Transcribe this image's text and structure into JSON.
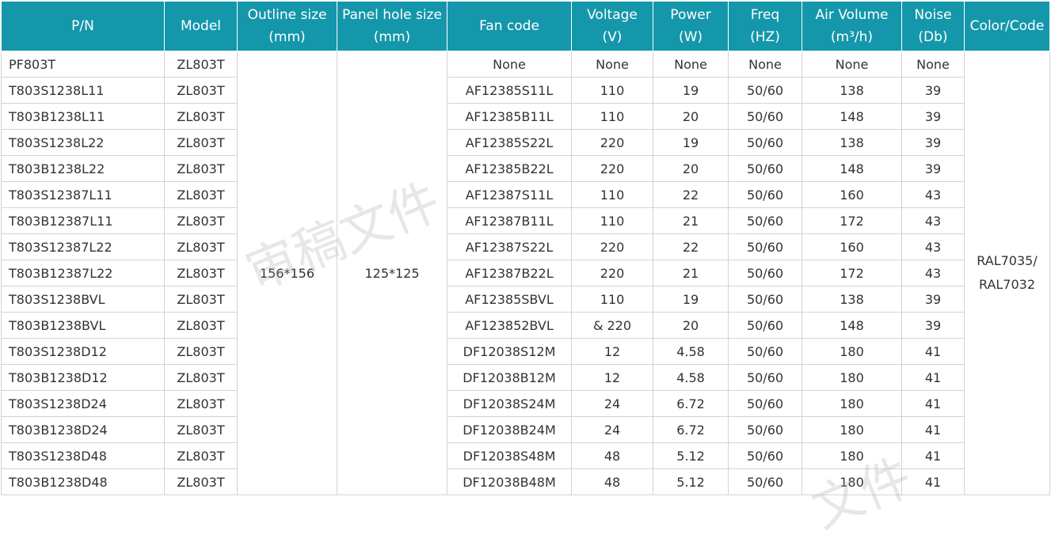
{
  "header": {
    "pn": [
      "P/N"
    ],
    "model": [
      "Model"
    ],
    "outline": [
      "Outline size",
      "(mm)"
    ],
    "panel": [
      "Panel hole size",
      "(mm)"
    ],
    "fan": [
      "Fan code"
    ],
    "voltage": [
      "Voltage",
      "(V)"
    ],
    "power": [
      "Power",
      "(W)"
    ],
    "freq": [
      "Freq",
      "(HZ)"
    ],
    "air": [
      "Air Volume",
      "(m³/h)"
    ],
    "noise": [
      "Noise",
      "(Db)"
    ],
    "color": [
      "Color/Code"
    ]
  },
  "merged": {
    "outline_size": "156*156",
    "panel_hole_size": "125*125",
    "color_code": [
      "RAL7035/",
      "RAL7032"
    ]
  },
  "rows": [
    {
      "pn": "PF803T",
      "model": "ZL803T",
      "fan": "None",
      "voltage": "None",
      "power": "None",
      "freq": "None",
      "air": "None",
      "noise": "None"
    },
    {
      "pn": "T803S1238L11",
      "model": "ZL803T",
      "fan": "AF12385S11L",
      "voltage": "110",
      "power": "19",
      "freq": "50/60",
      "air": "138",
      "noise": "39"
    },
    {
      "pn": "T803B1238L11",
      "model": "ZL803T",
      "fan": "AF12385B11L",
      "voltage": "110",
      "power": "20",
      "freq": "50/60",
      "air": "148",
      "noise": "39"
    },
    {
      "pn": "T803S1238L22",
      "model": "ZL803T",
      "fan": "AF12385S22L",
      "voltage": "220",
      "power": "19",
      "freq": "50/60",
      "air": "138",
      "noise": "39"
    },
    {
      "pn": "T803B1238L22",
      "model": "ZL803T",
      "fan": "AF12385B22L",
      "voltage": "220",
      "power": "20",
      "freq": "50/60",
      "air": "148",
      "noise": "39"
    },
    {
      "pn": "T803S12387L11",
      "model": "ZL803T",
      "fan": "AF12387S11L",
      "voltage": "110",
      "power": "22",
      "freq": "50/60",
      "air": "160",
      "noise": "43"
    },
    {
      "pn": "T803B12387L11",
      "model": "ZL803T",
      "fan": "AF12387B11L",
      "voltage": "110",
      "power": "21",
      "freq": "50/60",
      "air": "172",
      "noise": "43"
    },
    {
      "pn": "T803S12387L22",
      "model": "ZL803T",
      "fan": "AF12387S22L",
      "voltage": "220",
      "power": "22",
      "freq": "50/60",
      "air": "160",
      "noise": "43"
    },
    {
      "pn": "T803B12387L22",
      "model": "ZL803T",
      "fan": "AF12387B22L",
      "voltage": "220",
      "power": "21",
      "freq": "50/60",
      "air": "172",
      "noise": "43"
    },
    {
      "pn": "T803S1238BVL",
      "model": "ZL803T",
      "fan": "AF12385SBVL",
      "voltage": "110",
      "power": "19",
      "freq": "50/60",
      "air": "138",
      "noise": "39"
    },
    {
      "pn": "T803B1238BVL",
      "model": "ZL803T",
      "fan": "AF123852BVL",
      "voltage": "& 220",
      "power": "20",
      "freq": "50/60",
      "air": "148",
      "noise": "39"
    },
    {
      "pn": "T803S1238D12",
      "model": "ZL803T",
      "fan": "DF12038S12M",
      "voltage": "12",
      "power": "4.58",
      "freq": "50/60",
      "air": "180",
      "noise": "41"
    },
    {
      "pn": "T803B1238D12",
      "model": "ZL803T",
      "fan": "DF12038B12M",
      "voltage": "12",
      "power": "4.58",
      "freq": "50/60",
      "air": "180",
      "noise": "41"
    },
    {
      "pn": "T803S1238D24",
      "model": "ZL803T",
      "fan": "DF12038S24M",
      "voltage": "24",
      "power": "6.72",
      "freq": "50/60",
      "air": "180",
      "noise": "41"
    },
    {
      "pn": "T803B1238D24",
      "model": "ZL803T",
      "fan": "DF12038B24M",
      "voltage": "24",
      "power": "6.72",
      "freq": "50/60",
      "air": "180",
      "noise": "41"
    },
    {
      "pn": "T803S1238D48",
      "model": "ZL803T",
      "fan": "DF12038S48M",
      "voltage": "48",
      "power": "5.12",
      "freq": "50/60",
      "air": "180",
      "noise": "41"
    },
    {
      "pn": "T803B1238D48",
      "model": "ZL803T",
      "fan": "DF12038B48M",
      "voltage": "48",
      "power": "5.12",
      "freq": "50/60",
      "air": "180",
      "noise": "41"
    }
  ],
  "watermark": [
    "审稿文件",
    "文件"
  ],
  "colors": {
    "header_bg": "#1597ab",
    "header_text": "#ffffff",
    "border": "#cfd5d8",
    "text": "#333333"
  }
}
